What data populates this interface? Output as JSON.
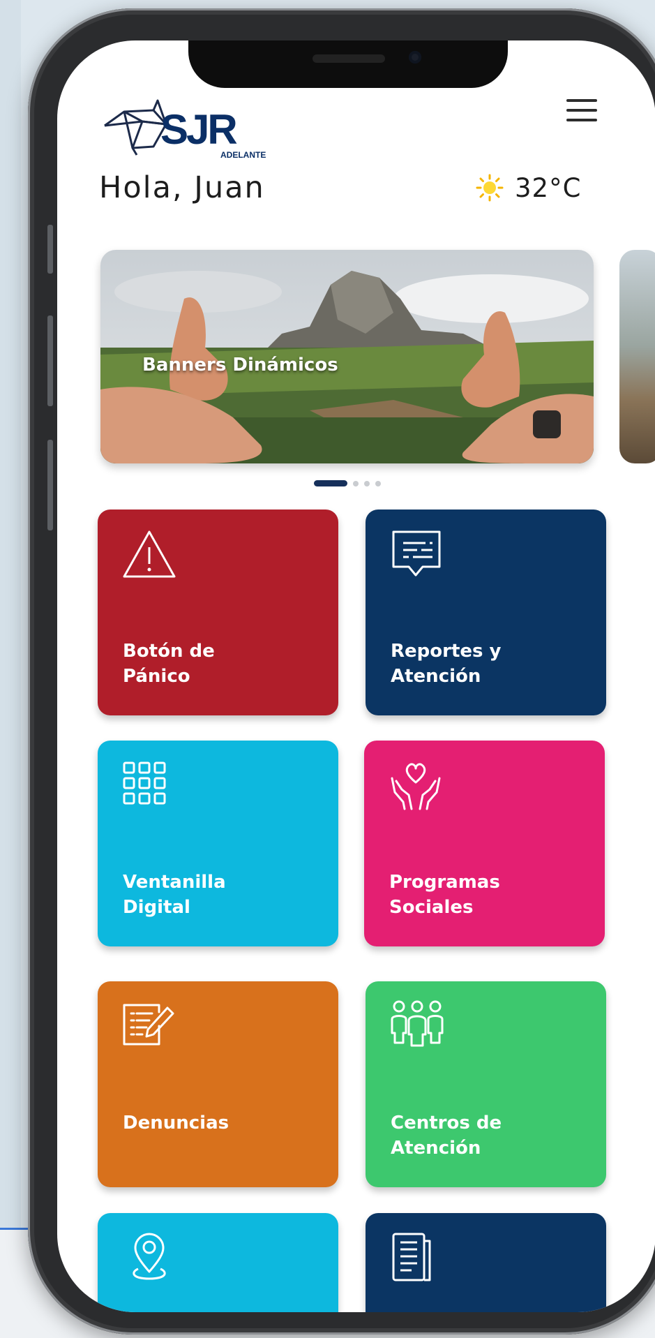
{
  "header": {
    "logo_text": "SJR",
    "logo_subtext": "ADELANTE",
    "greeting": "Hola, Juan",
    "temperature": "32°C"
  },
  "banner": {
    "title": "Banners Dinámicos",
    "page_count": 4,
    "active_page": 1
  },
  "tiles": [
    {
      "label": "Botón de\nPánico",
      "color": "#b01e2a",
      "icon": "warning-triangle-icon"
    },
    {
      "label": "Reportes y\nAtención",
      "color": "#0b3563",
      "icon": "chat-report-icon"
    },
    {
      "label": "Ventanilla\nDigital",
      "color": "#0db8de",
      "icon": "grid-icon"
    },
    {
      "label": "Programas\nSociales",
      "color": "#e41f72",
      "icon": "hands-heart-icon"
    },
    {
      "label": "Denuncias",
      "color": "#d8711c",
      "icon": "document-edit-icon"
    },
    {
      "label": "Centros de\nAtención",
      "color": "#3dc86e",
      "icon": "people-group-icon"
    },
    {
      "label": "",
      "color": "#0db8de",
      "icon": "location-pin-icon"
    },
    {
      "label": "",
      "color": "#0b3563",
      "icon": "newspaper-icon"
    }
  ]
}
